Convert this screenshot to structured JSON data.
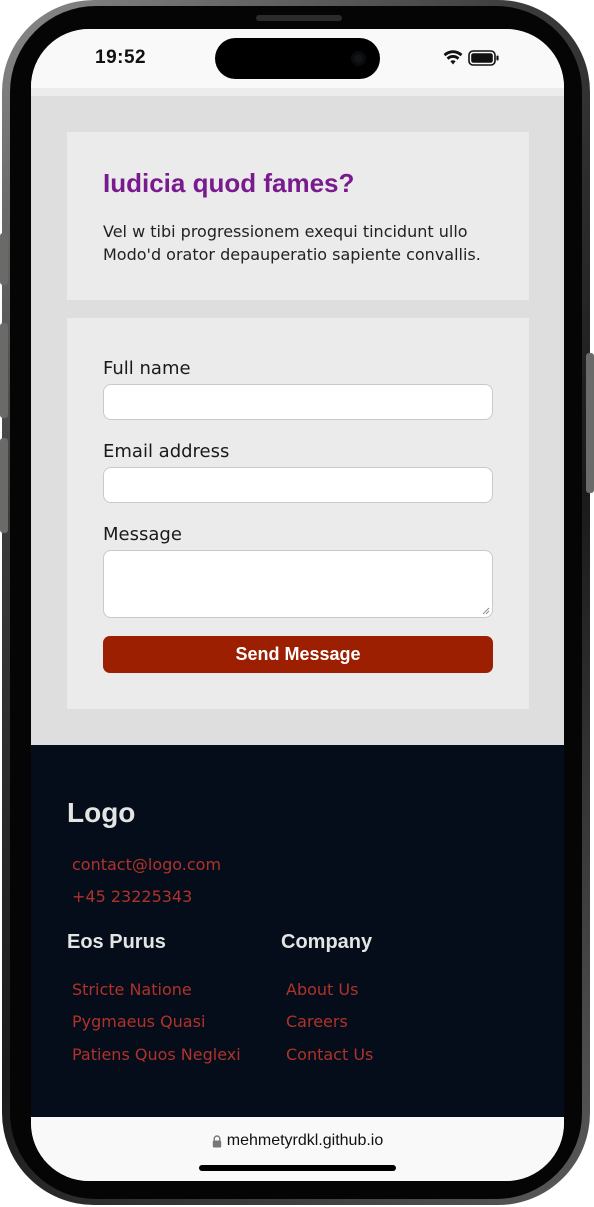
{
  "status_bar": {
    "time": "19:52",
    "wifi_icon": "wifi-icon",
    "battery_icon": "battery-icon"
  },
  "hero": {
    "title": "Iudicia quod fames?",
    "text": "Vel w tibi progressionem exequi tincidunt ullo Modo'd orator depauperatio sapiente convallis."
  },
  "form": {
    "fields": [
      {
        "label": "Full name",
        "value": "",
        "type": "text"
      },
      {
        "label": "Email address",
        "value": "",
        "type": "email"
      },
      {
        "label": "Message",
        "value": "",
        "type": "textarea"
      }
    ],
    "submit_label": "Send Message"
  },
  "footer": {
    "logo": "Logo",
    "contact": {
      "email": "contact@logo.com",
      "phone": "+45 23225343"
    },
    "columns": [
      {
        "heading": "Eos Purus",
        "links": [
          "Stricte Natione",
          "Pygmaeus Quasi",
          "Patiens Quos Neglexi"
        ]
      },
      {
        "heading": "Company",
        "links": [
          "About Us",
          "Careers",
          "Contact Us"
        ]
      }
    ]
  },
  "browser": {
    "url": "mehmetyrdkl.github.io",
    "lock_icon": "lock-icon"
  },
  "colors": {
    "title_purple": "#7a1a8f",
    "button_red": "#9b1f00",
    "footer_bg": "#040d19",
    "link_red": "#b0322a",
    "page_bg": "#dedede",
    "card_bg": "#ebebeb"
  }
}
